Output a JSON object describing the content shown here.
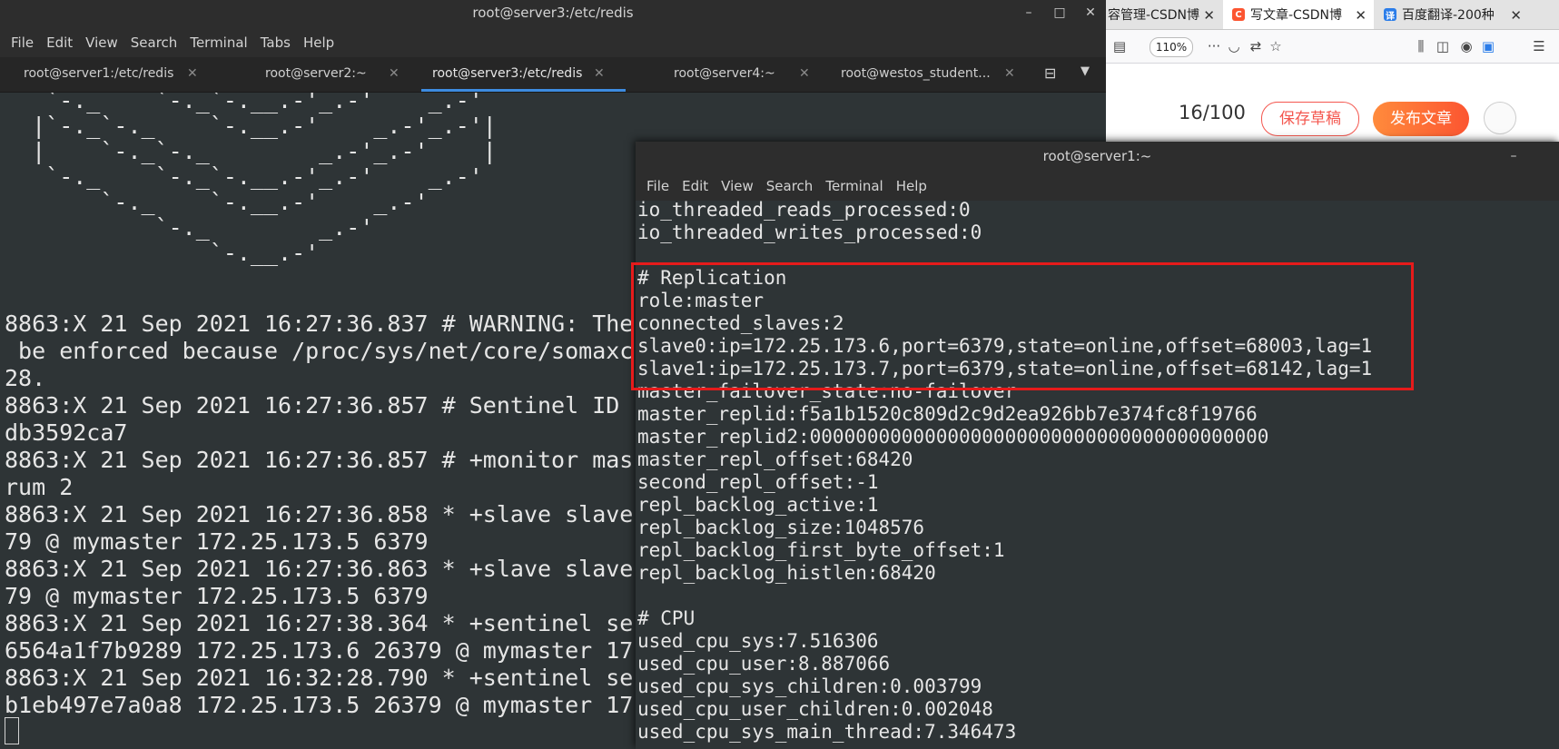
{
  "browser": {
    "tabs": [
      {
        "label": "容管理-CSDN博",
        "icon_color": "#e0e0e0"
      },
      {
        "label": "写文章-CSDN博",
        "icon_color": "#fc5531",
        "icon_char": "C"
      },
      {
        "label": "百度翻译-200种",
        "icon_color": "#2b7de9",
        "icon_char": "译"
      }
    ],
    "tab_close": "✕",
    "zoom": "110%",
    "word_counter": "16/100",
    "save_draft": "保存草稿",
    "publish": "发布文章"
  },
  "term3": {
    "title": "root@server3:/etc/redis",
    "menu": [
      "File",
      "Edit",
      "View",
      "Search",
      "Terminal",
      "Tabs",
      "Help"
    ],
    "tabs": [
      {
        "label": "root@server1:/etc/redis"
      },
      {
        "label": "root@server2:~"
      },
      {
        "label": "root@server3:/etc/redis"
      },
      {
        "label": "root@server4:~"
      },
      {
        "label": "root@westos_student..."
      }
    ],
    "tab_close": "✕",
    "win_minimize": "–",
    "win_maximize": "□",
    "win_close": "✕",
    "lines": [
      "   `-._    `-._`-.__.-'_.-'    _.-'",
      "  |`-._`-._    `-.__.-'    _.-'_.-'|",
      "  |    `-._`-._        _.-'_.-'    |",
      "   `-._    `-._`-.__.-'_.-'    _.-'",
      "       `-._    `-.__.-'    _.-'",
      "           `-._        _.-'",
      "               `-.__.-'",
      "",
      "8863:X 21 Sep 2021 16:27:36.837 # WARNING: The",
      " be enforced because /proc/sys/net/core/somaxc",
      "28.",
      "8863:X 21 Sep 2021 16:27:36.857 # Sentinel ID",
      "db3592ca7",
      "8863:X 21 Sep 2021 16:27:36.857 # +monitor mas",
      "rum 2",
      "8863:X 21 Sep 2021 16:27:36.858 * +slave slave",
      "79 @ mymaster 172.25.173.5 6379",
      "8863:X 21 Sep 2021 16:27:36.863 * +slave slave",
      "79 @ mymaster 172.25.173.5 6379",
      "8863:X 21 Sep 2021 16:27:38.364 * +sentinel se",
      "6564a1f7b9289 172.25.173.6 26379 @ mymaster 17",
      "8863:X 21 Sep 2021 16:32:28.790 * +sentinel se",
      "b1eb497e7a0a8 172.25.173.5 26379 @ mymaster 17"
    ]
  },
  "term1": {
    "title": "root@server1:~",
    "menu": [
      "File",
      "Edit",
      "View",
      "Search",
      "Terminal",
      "Help"
    ],
    "win_minimize": "–",
    "win_maximize": "□",
    "lines": [
      "io_threaded_reads_processed:0",
      "io_threaded_writes_processed:0",
      "",
      "# Replication",
      "role:master",
      "connected_slaves:2",
      "slave0:ip=172.25.173.6,port=6379,state=online,offset=68003,lag=1",
      "slave1:ip=172.25.173.7,port=6379,state=online,offset=68142,lag=1",
      "master_failover_state:no-failover",
      "master_replid:f5a1b1520c809d2c9d2ea926bb7e374fc8f19766",
      "master_replid2:0000000000000000000000000000000000000000",
      "master_repl_offset:68420",
      "second_repl_offset:-1",
      "repl_backlog_active:1",
      "repl_backlog_size:1048576",
      "repl_backlog_first_byte_offset:1",
      "repl_backlog_histlen:68420",
      "",
      "# CPU",
      "used_cpu_sys:7.516306",
      "used_cpu_user:8.887066",
      "used_cpu_sys_children:0.003799",
      "used_cpu_user_children:0.002048",
      "used_cpu_sys_main_thread:7.346473"
    ]
  },
  "colors": {
    "highlight": "#e61b1b",
    "terminal_bg": "#2e3436",
    "tab_accent": "#3d8be0",
    "publish": "#fc5531"
  }
}
